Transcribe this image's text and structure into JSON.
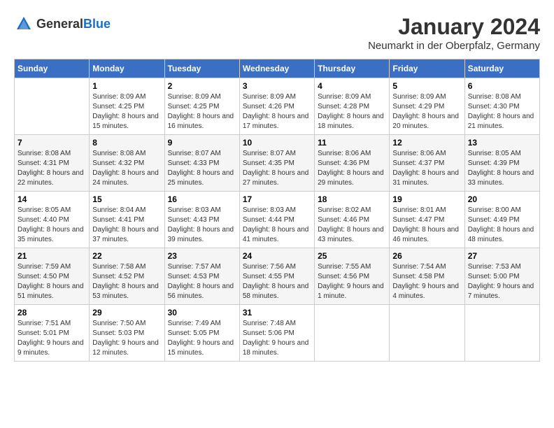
{
  "header": {
    "logo_general": "General",
    "logo_blue": "Blue",
    "month_title": "January 2024",
    "location": "Neumarkt in der Oberpfalz, Germany"
  },
  "days_of_week": [
    "Sunday",
    "Monday",
    "Tuesday",
    "Wednesday",
    "Thursday",
    "Friday",
    "Saturday"
  ],
  "weeks": [
    [
      {
        "day": "",
        "sunrise": "",
        "sunset": "",
        "daylight": ""
      },
      {
        "day": "1",
        "sunrise": "Sunrise: 8:09 AM",
        "sunset": "Sunset: 4:25 PM",
        "daylight": "Daylight: 8 hours and 15 minutes."
      },
      {
        "day": "2",
        "sunrise": "Sunrise: 8:09 AM",
        "sunset": "Sunset: 4:25 PM",
        "daylight": "Daylight: 8 hours and 16 minutes."
      },
      {
        "day": "3",
        "sunrise": "Sunrise: 8:09 AM",
        "sunset": "Sunset: 4:26 PM",
        "daylight": "Daylight: 8 hours and 17 minutes."
      },
      {
        "day": "4",
        "sunrise": "Sunrise: 8:09 AM",
        "sunset": "Sunset: 4:28 PM",
        "daylight": "Daylight: 8 hours and 18 minutes."
      },
      {
        "day": "5",
        "sunrise": "Sunrise: 8:09 AM",
        "sunset": "Sunset: 4:29 PM",
        "daylight": "Daylight: 8 hours and 20 minutes."
      },
      {
        "day": "6",
        "sunrise": "Sunrise: 8:08 AM",
        "sunset": "Sunset: 4:30 PM",
        "daylight": "Daylight: 8 hours and 21 minutes."
      }
    ],
    [
      {
        "day": "7",
        "sunrise": "Sunrise: 8:08 AM",
        "sunset": "Sunset: 4:31 PM",
        "daylight": "Daylight: 8 hours and 22 minutes."
      },
      {
        "day": "8",
        "sunrise": "Sunrise: 8:08 AM",
        "sunset": "Sunset: 4:32 PM",
        "daylight": "Daylight: 8 hours and 24 minutes."
      },
      {
        "day": "9",
        "sunrise": "Sunrise: 8:07 AM",
        "sunset": "Sunset: 4:33 PM",
        "daylight": "Daylight: 8 hours and 25 minutes."
      },
      {
        "day": "10",
        "sunrise": "Sunrise: 8:07 AM",
        "sunset": "Sunset: 4:35 PM",
        "daylight": "Daylight: 8 hours and 27 minutes."
      },
      {
        "day": "11",
        "sunrise": "Sunrise: 8:06 AM",
        "sunset": "Sunset: 4:36 PM",
        "daylight": "Daylight: 8 hours and 29 minutes."
      },
      {
        "day": "12",
        "sunrise": "Sunrise: 8:06 AM",
        "sunset": "Sunset: 4:37 PM",
        "daylight": "Daylight: 8 hours and 31 minutes."
      },
      {
        "day": "13",
        "sunrise": "Sunrise: 8:05 AM",
        "sunset": "Sunset: 4:39 PM",
        "daylight": "Daylight: 8 hours and 33 minutes."
      }
    ],
    [
      {
        "day": "14",
        "sunrise": "Sunrise: 8:05 AM",
        "sunset": "Sunset: 4:40 PM",
        "daylight": "Daylight: 8 hours and 35 minutes."
      },
      {
        "day": "15",
        "sunrise": "Sunrise: 8:04 AM",
        "sunset": "Sunset: 4:41 PM",
        "daylight": "Daylight: 8 hours and 37 minutes."
      },
      {
        "day": "16",
        "sunrise": "Sunrise: 8:03 AM",
        "sunset": "Sunset: 4:43 PM",
        "daylight": "Daylight: 8 hours and 39 minutes."
      },
      {
        "day": "17",
        "sunrise": "Sunrise: 8:03 AM",
        "sunset": "Sunset: 4:44 PM",
        "daylight": "Daylight: 8 hours and 41 minutes."
      },
      {
        "day": "18",
        "sunrise": "Sunrise: 8:02 AM",
        "sunset": "Sunset: 4:46 PM",
        "daylight": "Daylight: 8 hours and 43 minutes."
      },
      {
        "day": "19",
        "sunrise": "Sunrise: 8:01 AM",
        "sunset": "Sunset: 4:47 PM",
        "daylight": "Daylight: 8 hours and 46 minutes."
      },
      {
        "day": "20",
        "sunrise": "Sunrise: 8:00 AM",
        "sunset": "Sunset: 4:49 PM",
        "daylight": "Daylight: 8 hours and 48 minutes."
      }
    ],
    [
      {
        "day": "21",
        "sunrise": "Sunrise: 7:59 AM",
        "sunset": "Sunset: 4:50 PM",
        "daylight": "Daylight: 8 hours and 51 minutes."
      },
      {
        "day": "22",
        "sunrise": "Sunrise: 7:58 AM",
        "sunset": "Sunset: 4:52 PM",
        "daylight": "Daylight: 8 hours and 53 minutes."
      },
      {
        "day": "23",
        "sunrise": "Sunrise: 7:57 AM",
        "sunset": "Sunset: 4:53 PM",
        "daylight": "Daylight: 8 hours and 56 minutes."
      },
      {
        "day": "24",
        "sunrise": "Sunrise: 7:56 AM",
        "sunset": "Sunset: 4:55 PM",
        "daylight": "Daylight: 8 hours and 58 minutes."
      },
      {
        "day": "25",
        "sunrise": "Sunrise: 7:55 AM",
        "sunset": "Sunset: 4:56 PM",
        "daylight": "Daylight: 9 hours and 1 minute."
      },
      {
        "day": "26",
        "sunrise": "Sunrise: 7:54 AM",
        "sunset": "Sunset: 4:58 PM",
        "daylight": "Daylight: 9 hours and 4 minutes."
      },
      {
        "day": "27",
        "sunrise": "Sunrise: 7:53 AM",
        "sunset": "Sunset: 5:00 PM",
        "daylight": "Daylight: 9 hours and 7 minutes."
      }
    ],
    [
      {
        "day": "28",
        "sunrise": "Sunrise: 7:51 AM",
        "sunset": "Sunset: 5:01 PM",
        "daylight": "Daylight: 9 hours and 9 minutes."
      },
      {
        "day": "29",
        "sunrise": "Sunrise: 7:50 AM",
        "sunset": "Sunset: 5:03 PM",
        "daylight": "Daylight: 9 hours and 12 minutes."
      },
      {
        "day": "30",
        "sunrise": "Sunrise: 7:49 AM",
        "sunset": "Sunset: 5:05 PM",
        "daylight": "Daylight: 9 hours and 15 minutes."
      },
      {
        "day": "31",
        "sunrise": "Sunrise: 7:48 AM",
        "sunset": "Sunset: 5:06 PM",
        "daylight": "Daylight: 9 hours and 18 minutes."
      },
      {
        "day": "",
        "sunrise": "",
        "sunset": "",
        "daylight": ""
      },
      {
        "day": "",
        "sunrise": "",
        "sunset": "",
        "daylight": ""
      },
      {
        "day": "",
        "sunrise": "",
        "sunset": "",
        "daylight": ""
      }
    ]
  ]
}
